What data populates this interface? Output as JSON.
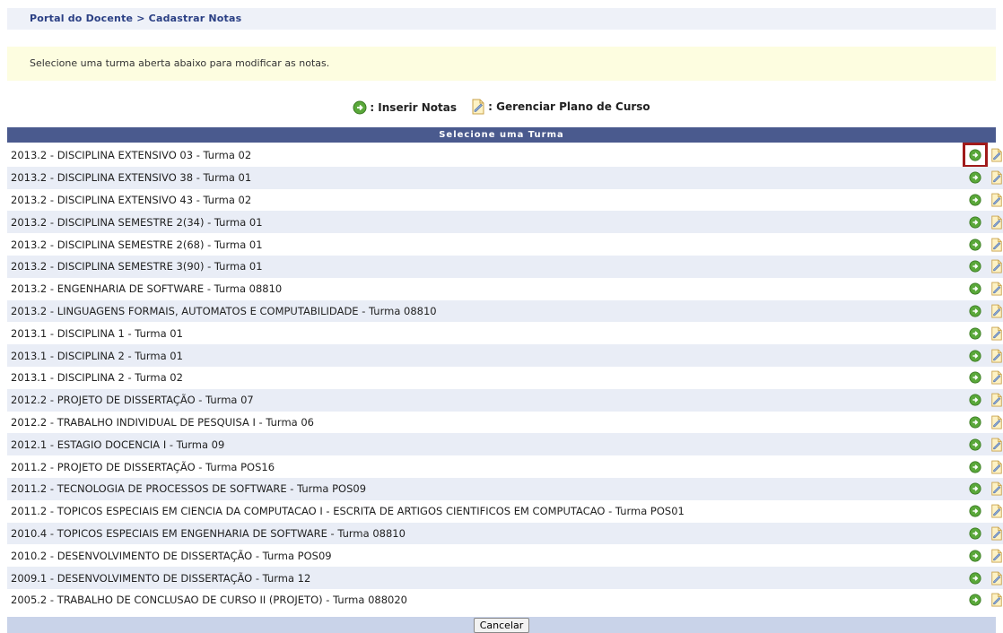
{
  "breadcrumb": "Portal do Docente > Cadastrar Notas",
  "info_text": "Selecione uma turma aberta abaixo para modificar as notas.",
  "legend": {
    "insert_label": ": Inserir Notas",
    "plan_label": ": Gerenciar Plano de Curso"
  },
  "table_title": "Selecione uma Turma",
  "rows": [
    "2013.2 - DISCIPLINA EXTENSIVO 03 - Turma 02",
    "2013.2 - DISCIPLINA EXTENSIVO 38 - Turma 01",
    "2013.2 - DISCIPLINA EXTENSIVO 43 - Turma 02",
    "2013.2 - DISCIPLINA SEMESTRE 2(34) - Turma 01",
    "2013.2 - DISCIPLINA SEMESTRE 2(68) - Turma 01",
    "2013.2 - DISCIPLINA SEMESTRE 3(90) - Turma 01",
    "2013.2 - ENGENHARIA DE SOFTWARE - Turma 08810",
    "2013.2 - LINGUAGENS FORMAIS, AUTOMATOS E COMPUTABILIDADE - Turma 08810",
    "2013.1 - DISCIPLINA 1 - Turma 01",
    "2013.1 - DISCIPLINA 2 - Turma 01",
    "2013.1 - DISCIPLINA 2 - Turma 02",
    "2012.2 - PROJETO DE DISSERTAÇÃO - Turma 07",
    "2012.2 - TRABALHO INDIVIDUAL DE PESQUISA I - Turma 06",
    "2012.1 - ESTAGIO DOCENCIA I - Turma 09",
    "2011.2 - PROJETO DE DISSERTAÇÃO - Turma POS16",
    "2011.2 - TECNOLOGIA DE PROCESSOS DE SOFTWARE - Turma POS09",
    "2011.2 - TOPICOS ESPECIAIS EM CIENCIA DA COMPUTACAO I - ESCRITA DE ARTIGOS CIENTIFICOS EM COMPUTACAO - Turma POS01",
    "2010.4 - TOPICOS ESPECIAIS EM ENGENHARIA DE SOFTWARE - Turma 08810",
    "2010.2 - DESENVOLVIMENTO DE DISSERTAÇÃO - Turma POS09",
    "2009.1 - DESENVOLVIMENTO DE DISSERTAÇÃO - Turma 12",
    "2005.2 - TRABALHO DE CONCLUSAO DE CURSO II (PROJETO) - Turma 088020"
  ],
  "cancel_label": "Cancelar",
  "icons": {
    "insert": "green-arrow-circle-icon",
    "plan": "document-edit-icon"
  },
  "colors": {
    "header_bg": "#4a5a8e",
    "row_alt": "#e9edf6",
    "info_bg": "#fdfde0",
    "highlight": "#a01a1a"
  }
}
